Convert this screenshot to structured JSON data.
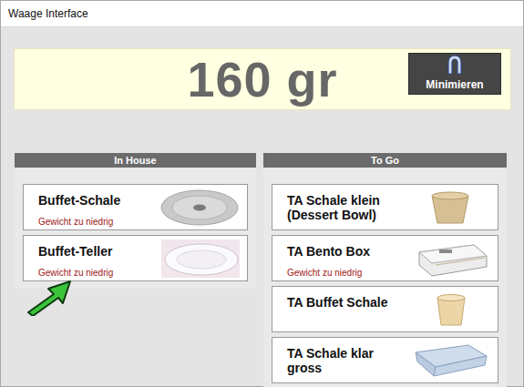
{
  "window": {
    "title": "Waage Interface"
  },
  "display": {
    "weight": "160 gr"
  },
  "minimize_button": {
    "label": "Minimieren"
  },
  "sections": [
    {
      "title": "In House",
      "items": [
        {
          "name": "Buffet-Schale",
          "warning": "Gewicht zu niedrig",
          "kind": "dish"
        },
        {
          "name": "Buffet-Teller",
          "warning": "Gewicht zu niedrig",
          "kind": "plate"
        }
      ]
    },
    {
      "title": "To Go",
      "items": [
        {
          "name": "TA Schale klein (Dessert Bowl)",
          "kind": "bowl"
        },
        {
          "name": "TA Bento Box",
          "warning": "Gewicht zu niedrig",
          "kind": "bento"
        },
        {
          "name": "TA Buffet Schale",
          "kind": "cup"
        },
        {
          "name": "TA Schale klar gross",
          "kind": "tray"
        }
      ]
    }
  ]
}
